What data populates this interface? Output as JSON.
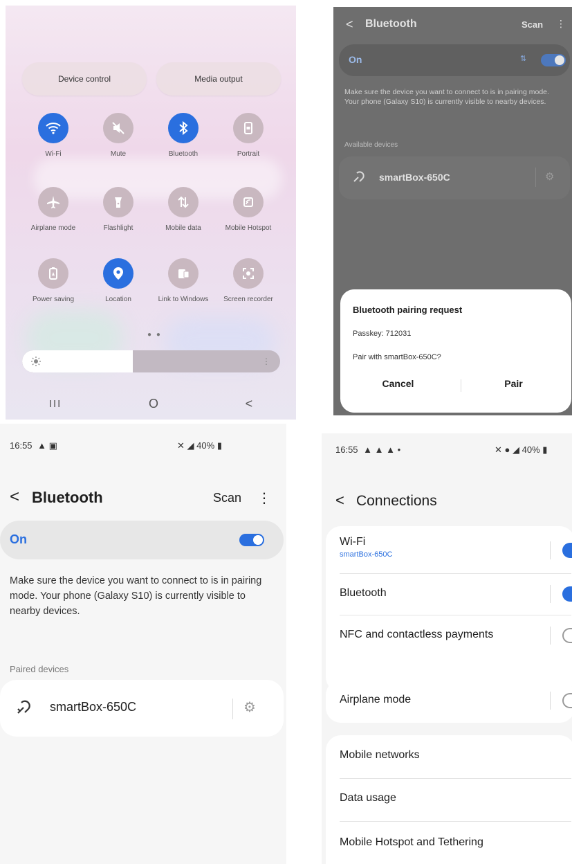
{
  "quick_panel": {
    "device_control": "Device control",
    "media_output": "Media output",
    "tiles": [
      {
        "label": "Wi-Fi",
        "icon": "wifi-icon",
        "active": true
      },
      {
        "label": "Mute",
        "icon": "mute-icon",
        "active": false
      },
      {
        "label": "Bluetooth",
        "icon": "bluetooth-icon",
        "active": true
      },
      {
        "label": "Portrait",
        "icon": "portrait-lock-icon",
        "active": false
      },
      {
        "label": "Airplane mode",
        "icon": "airplane-icon",
        "active": false
      },
      {
        "label": "Flashlight",
        "icon": "flashlight-icon",
        "active": false
      },
      {
        "label": "Mobile data",
        "icon": "mobile-data-icon",
        "active": false
      },
      {
        "label": "Mobile Hotspot",
        "icon": "hotspot-icon",
        "active": false
      },
      {
        "label": "Power saving",
        "icon": "battery-icon",
        "active": false
      },
      {
        "label": "Location",
        "icon": "location-pin-icon",
        "active": true
      },
      {
        "label": "Link to Windows",
        "icon": "link-to-windows-icon",
        "active": false
      },
      {
        "label": "Screen recorder",
        "icon": "screen-recorder-icon",
        "active": false
      }
    ],
    "brightness_level": 0.43,
    "nav": {
      "recents": "III",
      "home": "O",
      "back": "<"
    }
  },
  "bt_dialog_screen": {
    "title": "Bluetooth",
    "scan": "Scan",
    "on_label": "On",
    "description": "Make sure the device you want to connect to is in pairing mode. Your phone (Galaxy S10) is currently visible to nearby devices.",
    "section": "Available devices",
    "device": "smartBox-650C",
    "dialog": {
      "title": "Bluetooth pairing request",
      "passkey": "Passkey: 712031",
      "question": "Pair with smartBox-650C?",
      "cancel": "Cancel",
      "pair": "Pair"
    }
  },
  "bt_screen": {
    "status": {
      "time": "16:55",
      "battery": "40%"
    },
    "title": "Bluetooth",
    "scan": "Scan",
    "on_label": "On",
    "description": "Make sure the device you want to connect to is in pairing mode. Your phone (Galaxy S10) is currently visible to nearby devices.",
    "section": "Paired devices",
    "device": "smartBox-650C"
  },
  "connections_screen": {
    "status": {
      "time": "16:55",
      "battery": "40%"
    },
    "title": "Connections",
    "wifi": {
      "label": "Wi-Fi",
      "sub": "smartBox-650C"
    },
    "bluetooth": "Bluetooth",
    "nfc": "NFC and contactless payments",
    "airplane": "Airplane mode",
    "mobile_networks": "Mobile networks",
    "data_usage": "Data usage",
    "hotspot": "Mobile Hotspot and Tethering"
  },
  "colors": {
    "accent": "#2a6fdf",
    "dim_bg": "#6e6e6e"
  }
}
